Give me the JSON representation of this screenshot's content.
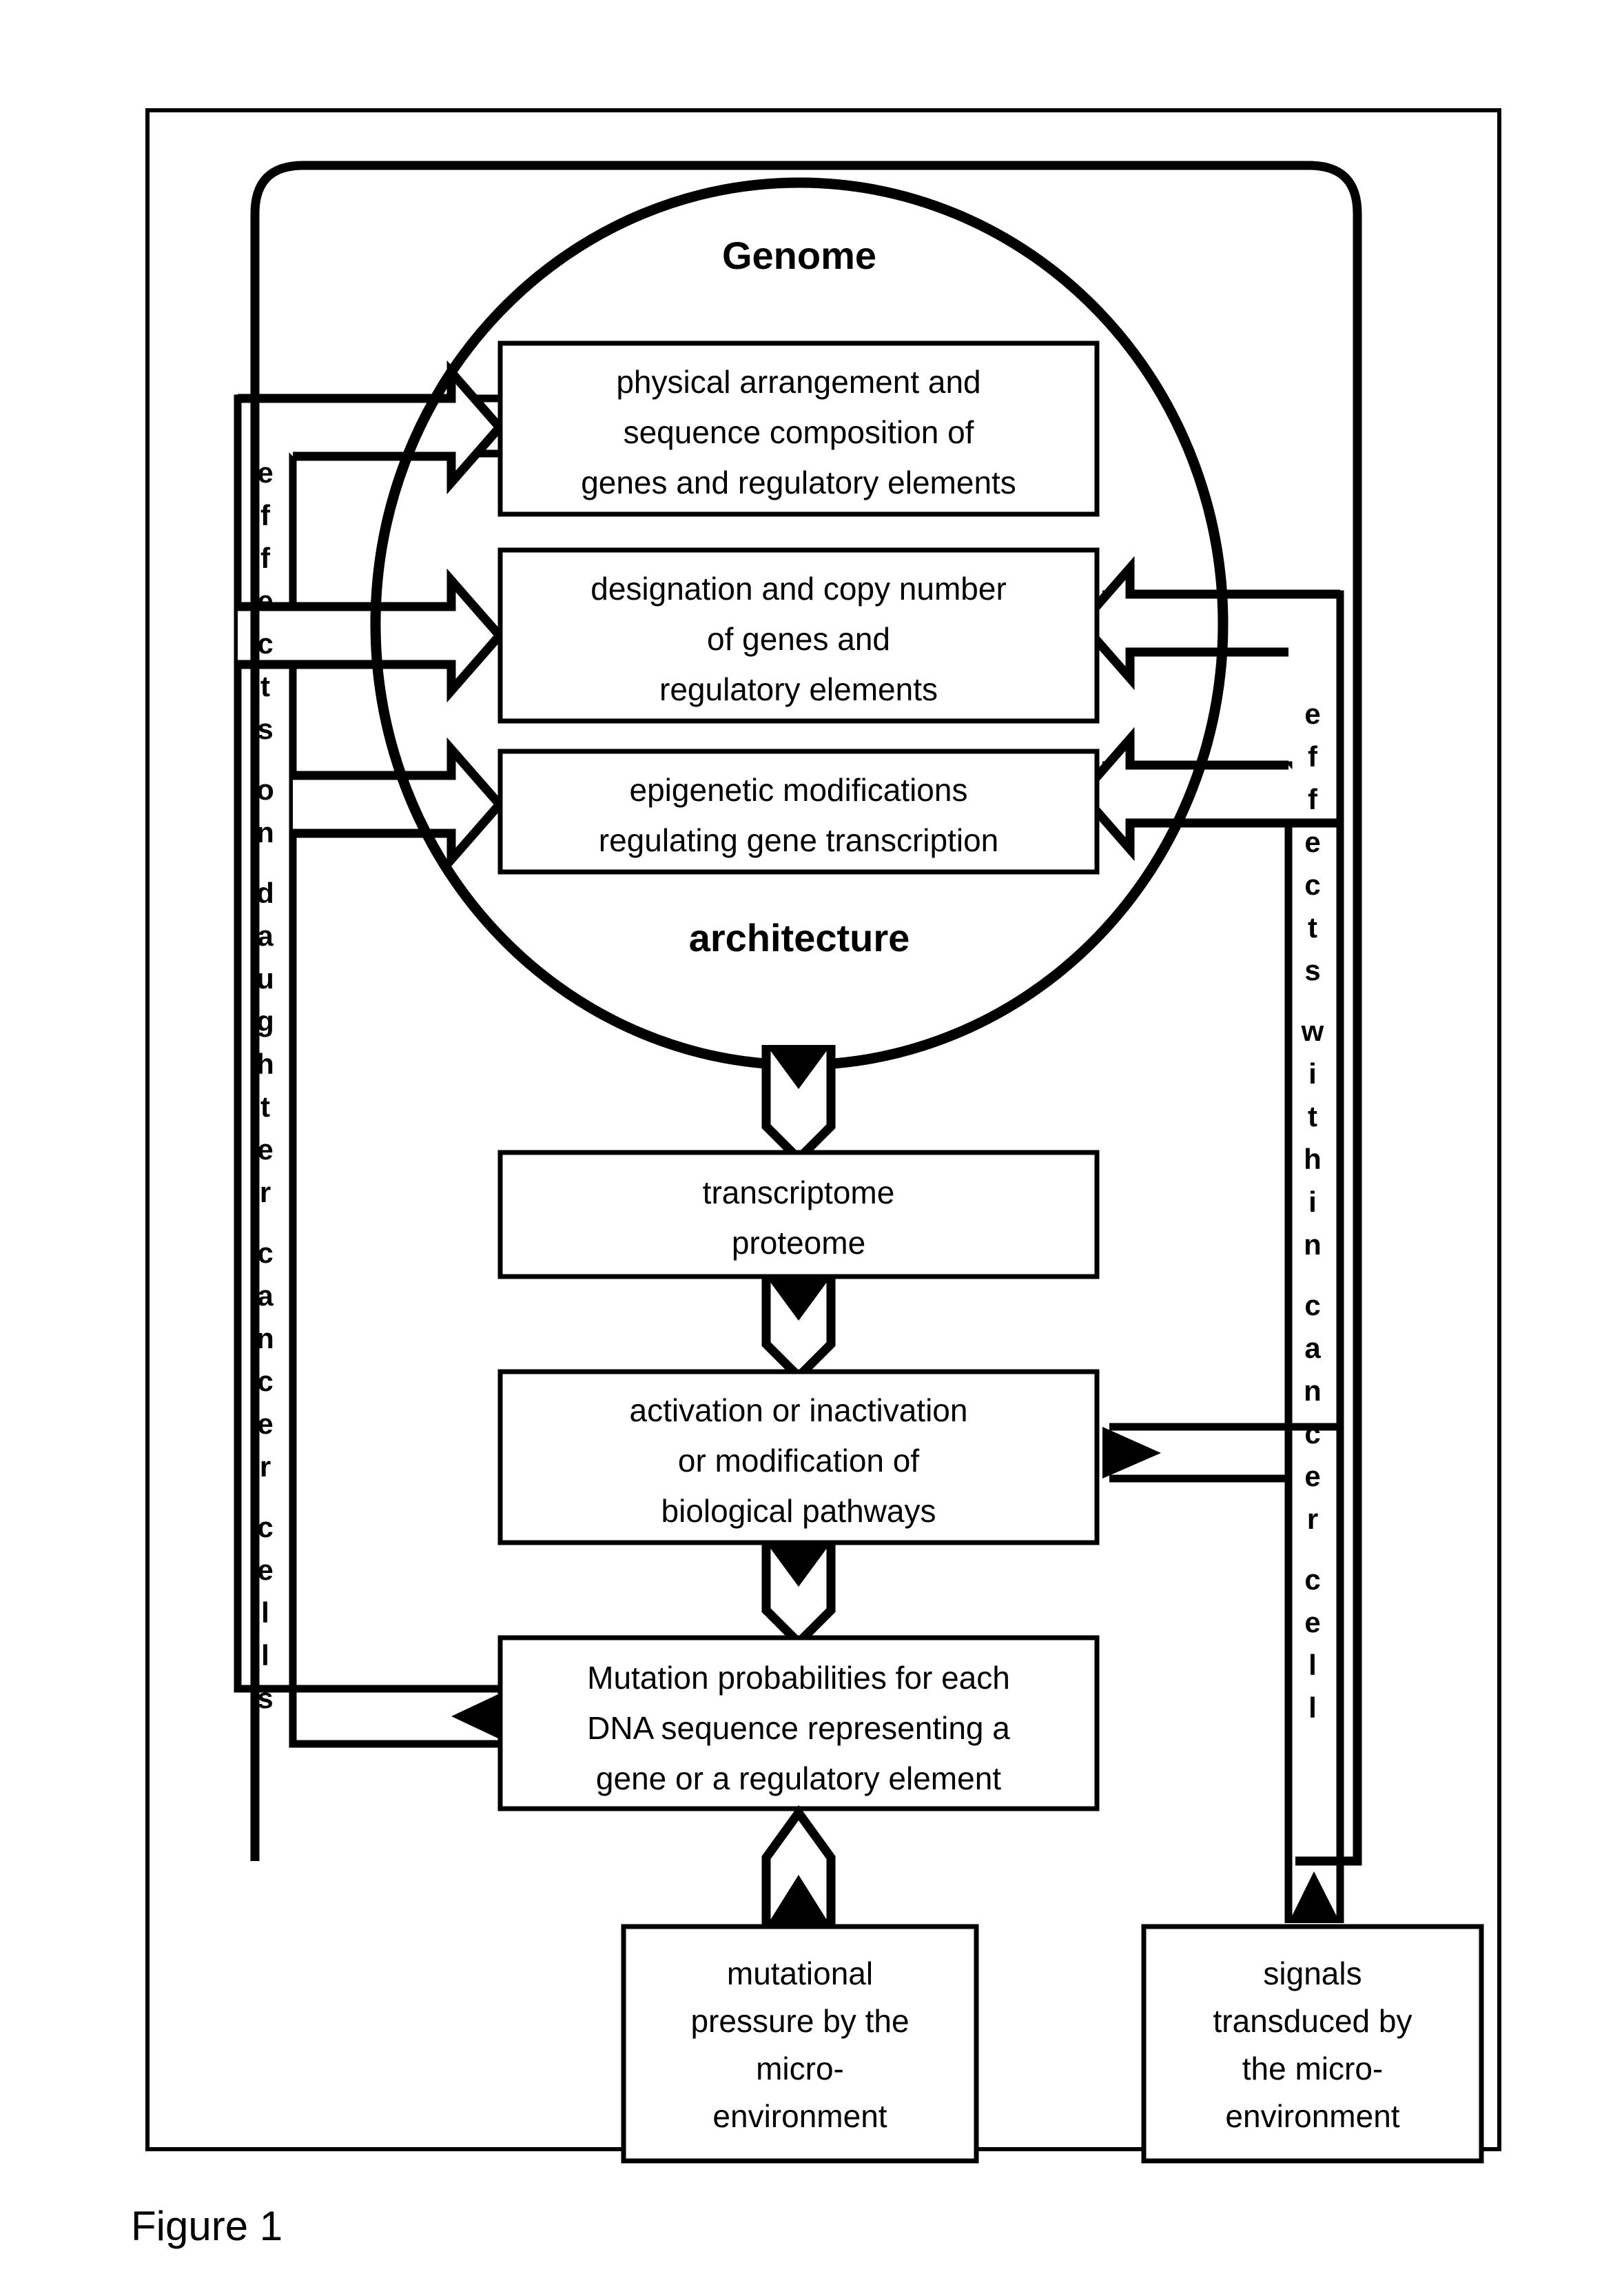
{
  "figure": {
    "caption": "Figure 1",
    "circle_top_label": "Genome",
    "circle_bottom_label": "architecture",
    "left_channel_label": "effects on daughter cancer cells",
    "right_channel_label": "effects within cancer cell",
    "colors": {
      "ink": "#000000",
      "paper": "#ffffff"
    }
  },
  "boxes": {
    "genome_items": [
      {
        "id": "physical-arrangement",
        "lines": [
          "physical arrangement and",
          "sequence composition of",
          "genes and regulatory elements"
        ]
      },
      {
        "id": "designation-copy-number",
        "lines": [
          "designation and copy number",
          "of genes and",
          "regulatory elements"
        ]
      },
      {
        "id": "epigenetic-modifications",
        "lines": [
          "epigenetic modifications",
          "regulating gene transcription"
        ]
      }
    ],
    "flow_items": [
      {
        "id": "transcriptome-proteome",
        "lines": [
          "transcriptome",
          "proteome"
        ]
      },
      {
        "id": "pathways",
        "lines": [
          "activation or inactivation",
          "or modification of",
          "biological pathways"
        ]
      },
      {
        "id": "mutation-probabilities",
        "lines": [
          "Mutation probabilities for each",
          "DNA sequence representing a",
          "gene or a regulatory element"
        ]
      }
    ],
    "environment_items": [
      {
        "id": "mutational-pressure",
        "lines": [
          "mutational",
          "pressure by the",
          "micro-",
          "environment"
        ]
      },
      {
        "id": "signals-transduced",
        "lines": [
          "signals",
          "transduced by",
          "the micro-",
          "environment"
        ]
      }
    ]
  },
  "chart_data": {
    "type": "diagram",
    "title": "Figure 1",
    "nodes": [
      "physical arrangement and sequence composition of genes and regulatory elements",
      "designation and copy number of genes and regulatory elements",
      "epigenetic modifications regulating gene transcription",
      "transcriptome proteome",
      "activation or inactivation or modification of biological pathways",
      "Mutation probabilities for each DNA sequence representing a gene or a regulatory element",
      "mutational pressure by the micro-environment",
      "signals transduced by the micro-environment"
    ],
    "groups": [
      {
        "label": "Genome architecture",
        "members": [
          0,
          1,
          2
        ]
      }
    ],
    "edges": [
      {
        "from": "Genome architecture",
        "to": "transcriptome proteome",
        "style": "hollow-down"
      },
      {
        "from": "transcriptome proteome",
        "to": "activation or inactivation or modification of biological pathways",
        "style": "hollow-down"
      },
      {
        "from": "activation or inactivation or modification of biological pathways",
        "to": "Mutation probabilities for each DNA sequence representing a gene or a regulatory element",
        "style": "hollow-down"
      },
      {
        "from": "mutational pressure by the micro-environment",
        "to": "Mutation probabilities for each DNA sequence representing a gene or a regulatory element",
        "style": "hollow-up"
      },
      {
        "from": "Mutation probabilities for each DNA sequence representing a gene or a regulatory element",
        "to": "physical arrangement and sequence composition of genes and regulatory elements",
        "style": "hollow-left-channel",
        "channel": "effects on daughter cancer cells"
      },
      {
        "from": "Mutation probabilities for each DNA sequence representing a gene or a regulatory element",
        "to": "designation and copy number of genes and regulatory elements",
        "style": "hollow-left-channel",
        "channel": "effects on daughter cancer cells"
      },
      {
        "from": "Mutation probabilities for each DNA sequence representing a gene or a regulatory element",
        "to": "epigenetic modifications regulating gene transcription",
        "style": "hollow-left-channel",
        "channel": "effects on daughter cancer cells"
      },
      {
        "from": "activation or inactivation or modification of biological pathways",
        "to": "designation and copy number of genes and regulatory elements",
        "style": "hollow-right-channel",
        "channel": "effects within cancer cell"
      },
      {
        "from": "activation or inactivation or modification of biological pathways",
        "to": "epigenetic modifications regulating gene transcription",
        "style": "hollow-right-channel",
        "channel": "effects within cancer cell"
      },
      {
        "from": "signals transduced by the micro-environment",
        "to": "activation or inactivation or modification of biological pathways",
        "style": "right-channel-up",
        "channel": "effects within cancer cell"
      }
    ]
  }
}
